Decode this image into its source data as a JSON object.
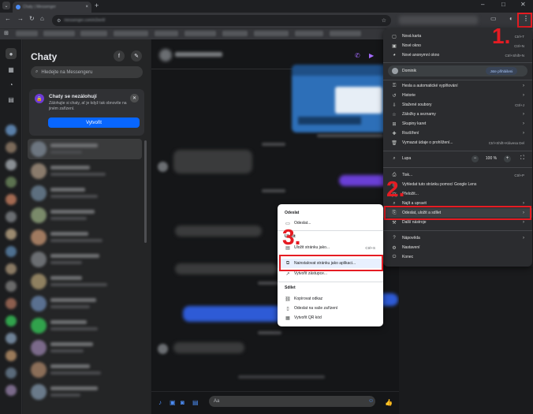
{
  "browser": {
    "tab_title": "Chaty | Messenger",
    "url_text": "messenger.com/e2ee/t/",
    "new_tab_glyph": "+",
    "min_glyph": "–",
    "max_glyph": "□",
    "close_glyph": "✕"
  },
  "messenger": {
    "title": "Chaty",
    "search_placeholder": "Hledejte na Messengeru",
    "backup_card": {
      "title": "Chaty se nezálohují",
      "body": "Zálohujte si chaty, ať je když tak obnovíte na jiném zařízení.",
      "button": "Vytvořit"
    },
    "composer_placeholder": "Aa"
  },
  "chrome_menu": {
    "items_top": [
      {
        "label": "Nová karta",
        "shortcut": "Ctrl+T",
        "icon": "new-tab-icon"
      },
      {
        "label": "Nové okno",
        "shortcut": "Ctrl+N",
        "icon": "new-window-icon"
      },
      {
        "label": "Nové anonymní okno",
        "shortcut": "Ctrl+Shift+N",
        "icon": "incognito-icon"
      }
    ],
    "profile": {
      "name": "Dominik",
      "badge": "Jste přihlášeni"
    },
    "items_mid": [
      {
        "label": "Hesla a automatické vyplňování",
        "arrow": "›"
      },
      {
        "label": "Historie",
        "arrow": "›"
      },
      {
        "label": "Stažené soubory",
        "shortcut": "Ctrl+J"
      },
      {
        "label": "Záložky a seznamy",
        "arrow": "›"
      },
      {
        "label": "Skupiny karet",
        "arrow": "›"
      },
      {
        "label": "Rozšíření",
        "arrow": "›"
      },
      {
        "label": "Vymazat údaje o prohlížení...",
        "shortcut": "Ctrl+Shift+Klávesa Del"
      }
    ],
    "zoom": {
      "label": "Lupa",
      "minus": "−",
      "value": "100 %",
      "plus": "+"
    },
    "items_low": [
      {
        "label": "Tisk...",
        "shortcut": "Ctrl+P"
      },
      {
        "label": "Vyhledat tuto stránku pomocí Google Lens"
      },
      {
        "label": "Přeložit..."
      },
      {
        "label": "Najít a upravit",
        "arrow": "›"
      },
      {
        "label": "Odeslat, uložit a sdílet",
        "arrow": "›"
      },
      {
        "label": "Další nástroje",
        "arrow": "›"
      }
    ],
    "items_bottom": [
      {
        "label": "Nápověda",
        "arrow": "›"
      },
      {
        "label": "Nastavení"
      },
      {
        "label": "Konec"
      }
    ]
  },
  "submenu": {
    "send_header": "Odeslat",
    "send_item": "Odeslat...",
    "save_header": "Uložit",
    "save_item": "Uložit stránku jako...",
    "save_shortcut": "Ctrl+S",
    "install_item": "Nainstalovat stránku jako aplikaci...",
    "shortcut_item": "Vytvořit zástupce...",
    "share_header": "Sdílet",
    "copy_link": "Kopírovat odkaz",
    "send_to_devices": "Odeslat na vaše zařízení",
    "qr_code": "Vytvořit QR kód"
  },
  "annotations": {
    "step1": "1.",
    "step2": "2.",
    "step3": "3.",
    "color": "#e51c23"
  }
}
